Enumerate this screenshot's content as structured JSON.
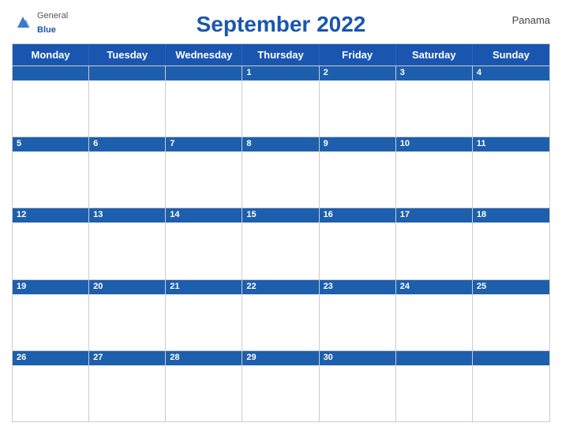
{
  "header": {
    "title": "September 2022",
    "country": "Panama",
    "logo": {
      "general": "General",
      "blue": "Blue"
    }
  },
  "days_of_week": [
    "Monday",
    "Tuesday",
    "Wednesday",
    "Thursday",
    "Friday",
    "Saturday",
    "Sunday"
  ],
  "weeks": [
    [
      {
        "num": "",
        "empty": true
      },
      {
        "num": "",
        "empty": true
      },
      {
        "num": "",
        "empty": true
      },
      {
        "num": "1"
      },
      {
        "num": "2"
      },
      {
        "num": "3"
      },
      {
        "num": "4"
      }
    ],
    [
      {
        "num": "5"
      },
      {
        "num": "6"
      },
      {
        "num": "7"
      },
      {
        "num": "8"
      },
      {
        "num": "9"
      },
      {
        "num": "10"
      },
      {
        "num": "11"
      }
    ],
    [
      {
        "num": "12"
      },
      {
        "num": "13"
      },
      {
        "num": "14"
      },
      {
        "num": "15"
      },
      {
        "num": "16"
      },
      {
        "num": "17"
      },
      {
        "num": "18"
      }
    ],
    [
      {
        "num": "19"
      },
      {
        "num": "20"
      },
      {
        "num": "21"
      },
      {
        "num": "22"
      },
      {
        "num": "23"
      },
      {
        "num": "24"
      },
      {
        "num": "25"
      }
    ],
    [
      {
        "num": "26"
      },
      {
        "num": "27"
      },
      {
        "num": "28"
      },
      {
        "num": "29"
      },
      {
        "num": "30"
      },
      {
        "num": "",
        "empty": true
      },
      {
        "num": "",
        "empty": true
      }
    ]
  ],
  "colors": {
    "header_blue": "#1a56b0",
    "row_blue": "#1e5fad",
    "border": "#ccc",
    "text_blue": "#1a56b0",
    "white": "#ffffff"
  }
}
